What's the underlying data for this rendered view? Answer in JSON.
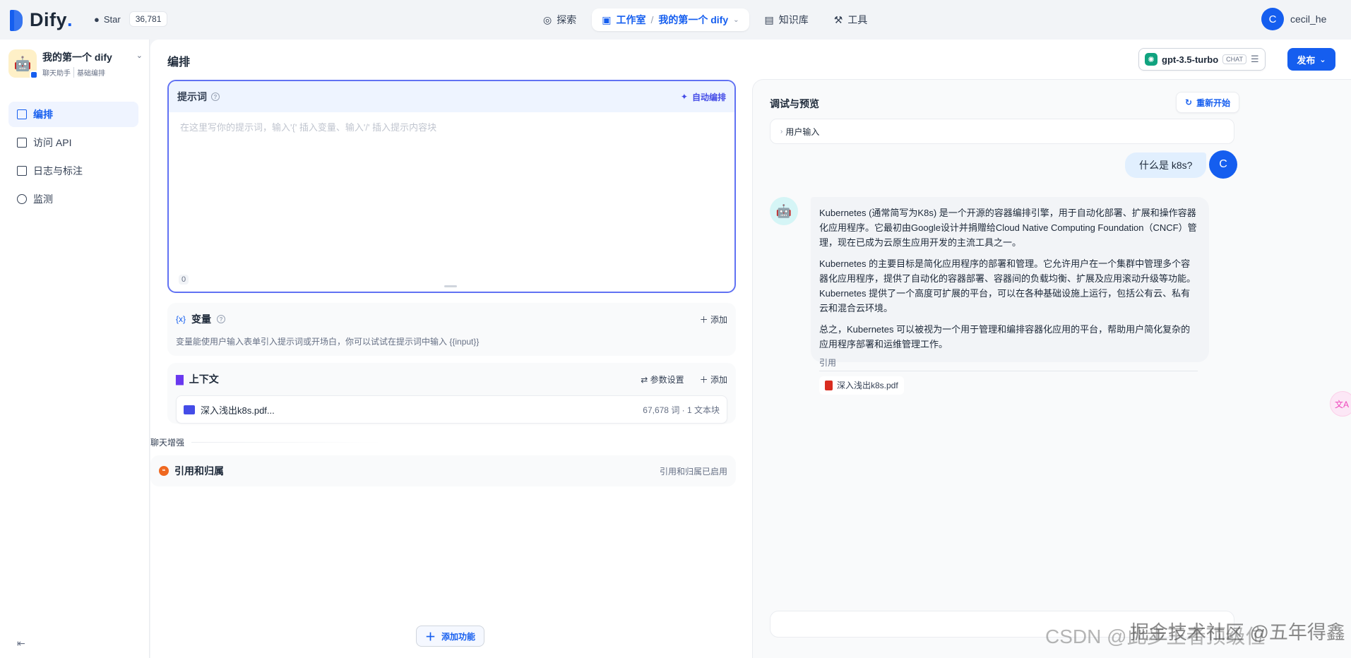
{
  "header": {
    "logo_text": "Dify",
    "github_star_label": "Star",
    "github_star_count": "36,781",
    "nav": {
      "explore": "探索",
      "studio": "工作室",
      "app_crumb": "我的第一个 dify",
      "knowledge": "知识库",
      "tools": "工具"
    },
    "user": {
      "avatar_letter": "C",
      "name": "cecil_he"
    }
  },
  "sidebar": {
    "app_name": "我的第一个 dify",
    "app_tags": [
      "聊天助手",
      "基础编排"
    ],
    "items": [
      {
        "label": "编排",
        "active": true
      },
      {
        "label": "访问 API",
        "active": false
      },
      {
        "label": "日志与标注",
        "active": false
      },
      {
        "label": "监测",
        "active": false
      }
    ]
  },
  "main": {
    "title": "编排",
    "model": {
      "name": "gpt-3.5-turbo",
      "badge": "CHAT"
    },
    "publish_label": "发布",
    "prompt": {
      "title": "提示词",
      "auto_label": "自动编排",
      "placeholder": "在这里写你的提示词，输入'{' 插入变量、输入'/' 插入提示内容块",
      "count": "0"
    },
    "variables": {
      "title": "变量",
      "add_label": "添加",
      "description": "变量能使用户输入表单引入提示词或开场白，你可以试试在提示词中输入 {{input}}"
    },
    "context": {
      "title": "上下文",
      "params_label": "参数设置",
      "add_label": "添加",
      "file_name": "深入浅出k8s.pdf...",
      "file_meta": "67,678 词 · 1 文本块"
    },
    "enhance_label": "聊天增强",
    "citation": {
      "title": "引用和归属",
      "status": "引用和归属已启用"
    },
    "add_feature_label": "添加功能"
  },
  "debug": {
    "title": "调试与预览",
    "restart_label": "重新开始",
    "user_input_label": "用户输入",
    "question": "什么是 k8s?",
    "user_avatar_letter": "C",
    "answer_paragraphs": [
      "Kubernetes (通常简写为K8s) 是一个开源的容器编排引擎，用于自动化部署、扩展和操作容器化应用程序。它最初由Google设计并捐赠给Cloud Native Computing Foundation（CNCF）管理，现在已成为云原生应用开发的主流工具之一。",
      "Kubernetes 的主要目标是简化应用程序的部署和管理。它允许用户在一个集群中管理多个容器化应用程序，提供了自动化的容器部署、容器间的负载均衡、扩展及应用滚动升级等功能。Kubernetes 提供了一个高度可扩展的平台，可以在各种基础设施上运行，包括公有云、私有云和混合云环境。",
      "总之，Kubernetes 可以被视为一个用于管理和编排容器化应用的平台，帮助用户简化复杂的应用程序部署和运维管理工作。"
    ],
    "citation_label": "引用",
    "citation_file": "深入浅出k8s.pdf"
  },
  "watermark": {
    "line1": "CSDN @此步王者顶级位",
    "line2": "掘金技术社区 @五年得鑫"
  },
  "colors": {
    "accent": "#155eef",
    "prompt_border": "#6172f3"
  }
}
